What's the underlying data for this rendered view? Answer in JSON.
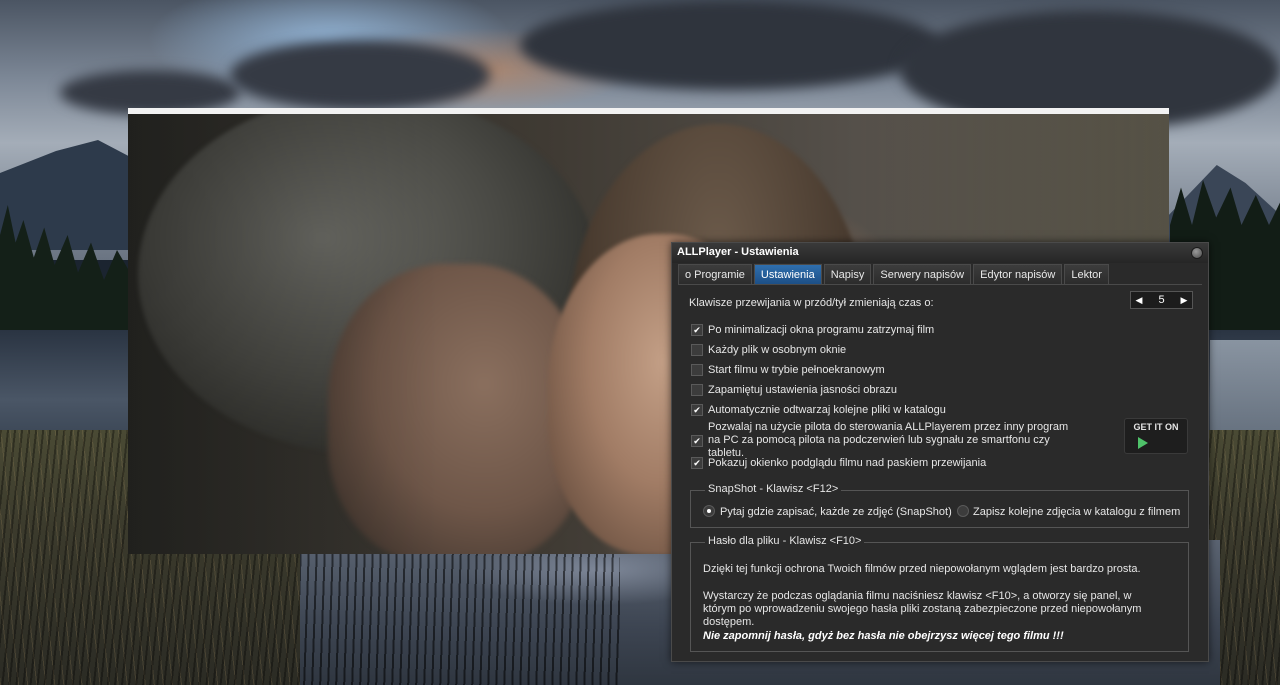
{
  "dialog": {
    "title": "ALLPlayer - Ustawienia",
    "tabs": [
      "o Programie",
      "Ustawienia",
      "Napisy",
      "Serwery napisów",
      "Edytor napisów",
      "Lektor"
    ],
    "active_tab": "Ustawienia"
  },
  "settings": {
    "rewind_label": "Klawisze przewijania w przód/tył zmieniają czas o:",
    "rewind_value": "5",
    "options": [
      {
        "label": "Po minimalizacji okna programu zatrzymaj film",
        "checked": true
      },
      {
        "label": "Każdy plik w osobnym oknie",
        "checked": false
      },
      {
        "label": "Start filmu w trybie pełnoekranowym",
        "checked": false
      },
      {
        "label": "Zapamiętuj ustawienia jasności obrazu",
        "checked": false
      },
      {
        "label": "Automatycznie odtwarzaj kolejne pliki w katalogu",
        "checked": true
      },
      {
        "label": "Pozwalaj na użycie pilota do sterowania ALLPlayerem przez inny program na PC za pomocą pilota na podczerwień lub sygnału ze smartfonu czy tabletu.",
        "checked": true
      },
      {
        "label": "Pokazuj okienko podglądu filmu nad paskiem przewijania",
        "checked": true
      }
    ],
    "store_badge": "GET IT ON"
  },
  "snapshot": {
    "title": "SnapShot - Klawisz <F12>",
    "option_ask": "Pytaj gdzie zapisać, każde ze zdjęć (SnapShot)",
    "option_save": "Zapisz kolejne zdjęcia w katalogu z filmem",
    "selected": "ask"
  },
  "password": {
    "title": "Hasło dla pliku - Klawisz <F10>",
    "para1": "Dzięki tej funkcji ochrona Twoich filmów przed niepowołanym wglądem jest bardzo prosta.",
    "para2": "Wystarczy że podczas oglądania filmu naciśniesz klawisz <F10>, a otworzy się panel, w którym po wprowadzeniu swojego hasła pliki zostaną zabezpieczone przed niepowołanym dostępem.",
    "warning": "Nie zapomnij hasła, gdyż bez hasła nie obejrzysz więcej tego filmu !!!"
  },
  "colors": {
    "active_tab": "#2f6fae",
    "dialog_bg": "#2a2a2a"
  },
  "icons": [
    "close-icon",
    "left-arrow-icon",
    "right-arrow-icon",
    "google-play-icon",
    "apple-icon"
  ]
}
